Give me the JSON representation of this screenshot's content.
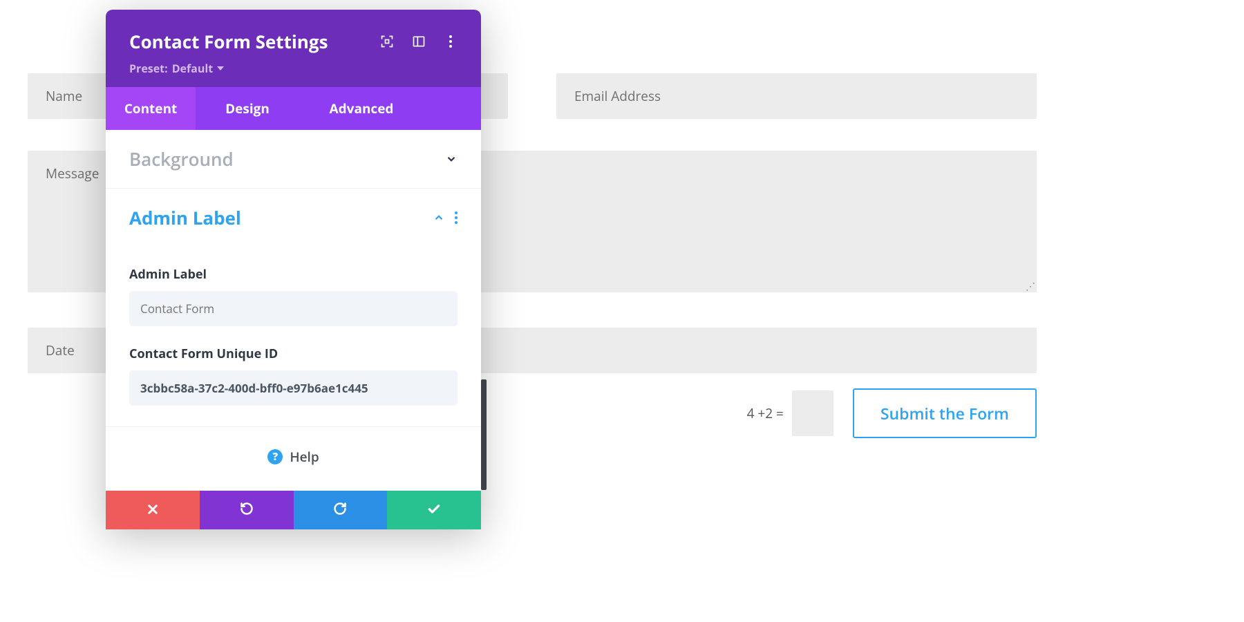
{
  "form": {
    "name_placeholder": "Name",
    "email_placeholder": "Email Address",
    "message_placeholder": "Message",
    "date_placeholder": "Date",
    "captcha_label": "4 +2 =",
    "submit_label": "Submit the Form"
  },
  "panel": {
    "title": "Contact Form Settings",
    "preset_prefix": "Preset: ",
    "preset_value": "Default",
    "tabs": {
      "content": "Content",
      "design": "Design",
      "advanced": "Advanced"
    },
    "sections": {
      "background": {
        "title": "Background"
      },
      "admin_label": {
        "title": "Admin Label",
        "field_label": "Admin Label",
        "field_placeholder": "Contact Form",
        "unique_id_label": "Contact Form Unique ID",
        "unique_id_value": "3cbbc58a-37c2-400d-bff0-e97b6ae1c445"
      }
    },
    "help_label": "Help"
  },
  "colors": {
    "accent_purple": "#6c2eb9",
    "accent_blue": "#2ea3f2"
  }
}
